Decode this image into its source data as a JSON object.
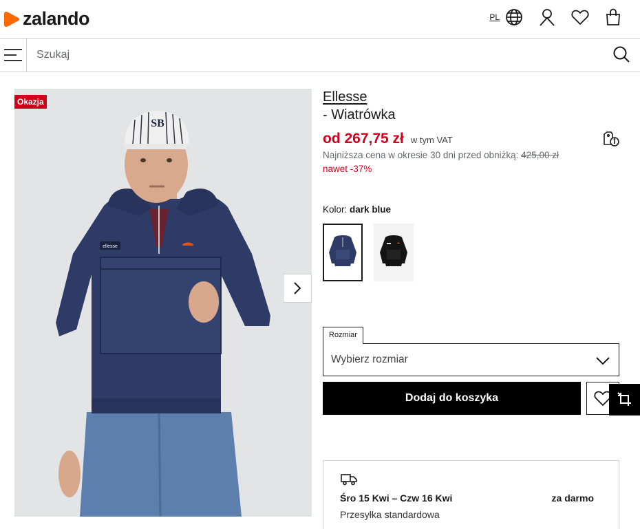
{
  "header": {
    "logo_text": "zalando",
    "lang": "PL",
    "icons": [
      "globe-icon",
      "user-icon",
      "heart-icon",
      "bag-icon"
    ]
  },
  "search": {
    "placeholder": "Szukaj"
  },
  "product": {
    "badge": "Okazja",
    "brand": "Ellesse",
    "name": "- Wiatrówka",
    "price": "od 267,75 zł",
    "vat": "w tym VAT",
    "lowest_prefix": "Najniższa cena w okresie 30 dni przed obniżką:",
    "lowest_price": "425,00 zł",
    "discount": "nawet -37%",
    "color_prefix": "Kolor:",
    "color_value": "dark blue",
    "size_tag": "Rozmiar",
    "size_placeholder": "Wybierz rozmiar",
    "add_to_cart": "Dodaj do koszyka"
  },
  "delivery": {
    "date": "Śro 15 Kwi – Czw 16 Kwi",
    "price": "za darmo",
    "type": "Przesyłka standardowa"
  },
  "colors": {
    "accent_red": "#d0021b",
    "brand_orange": "#ff6900",
    "jacket": "#2e3b66"
  }
}
